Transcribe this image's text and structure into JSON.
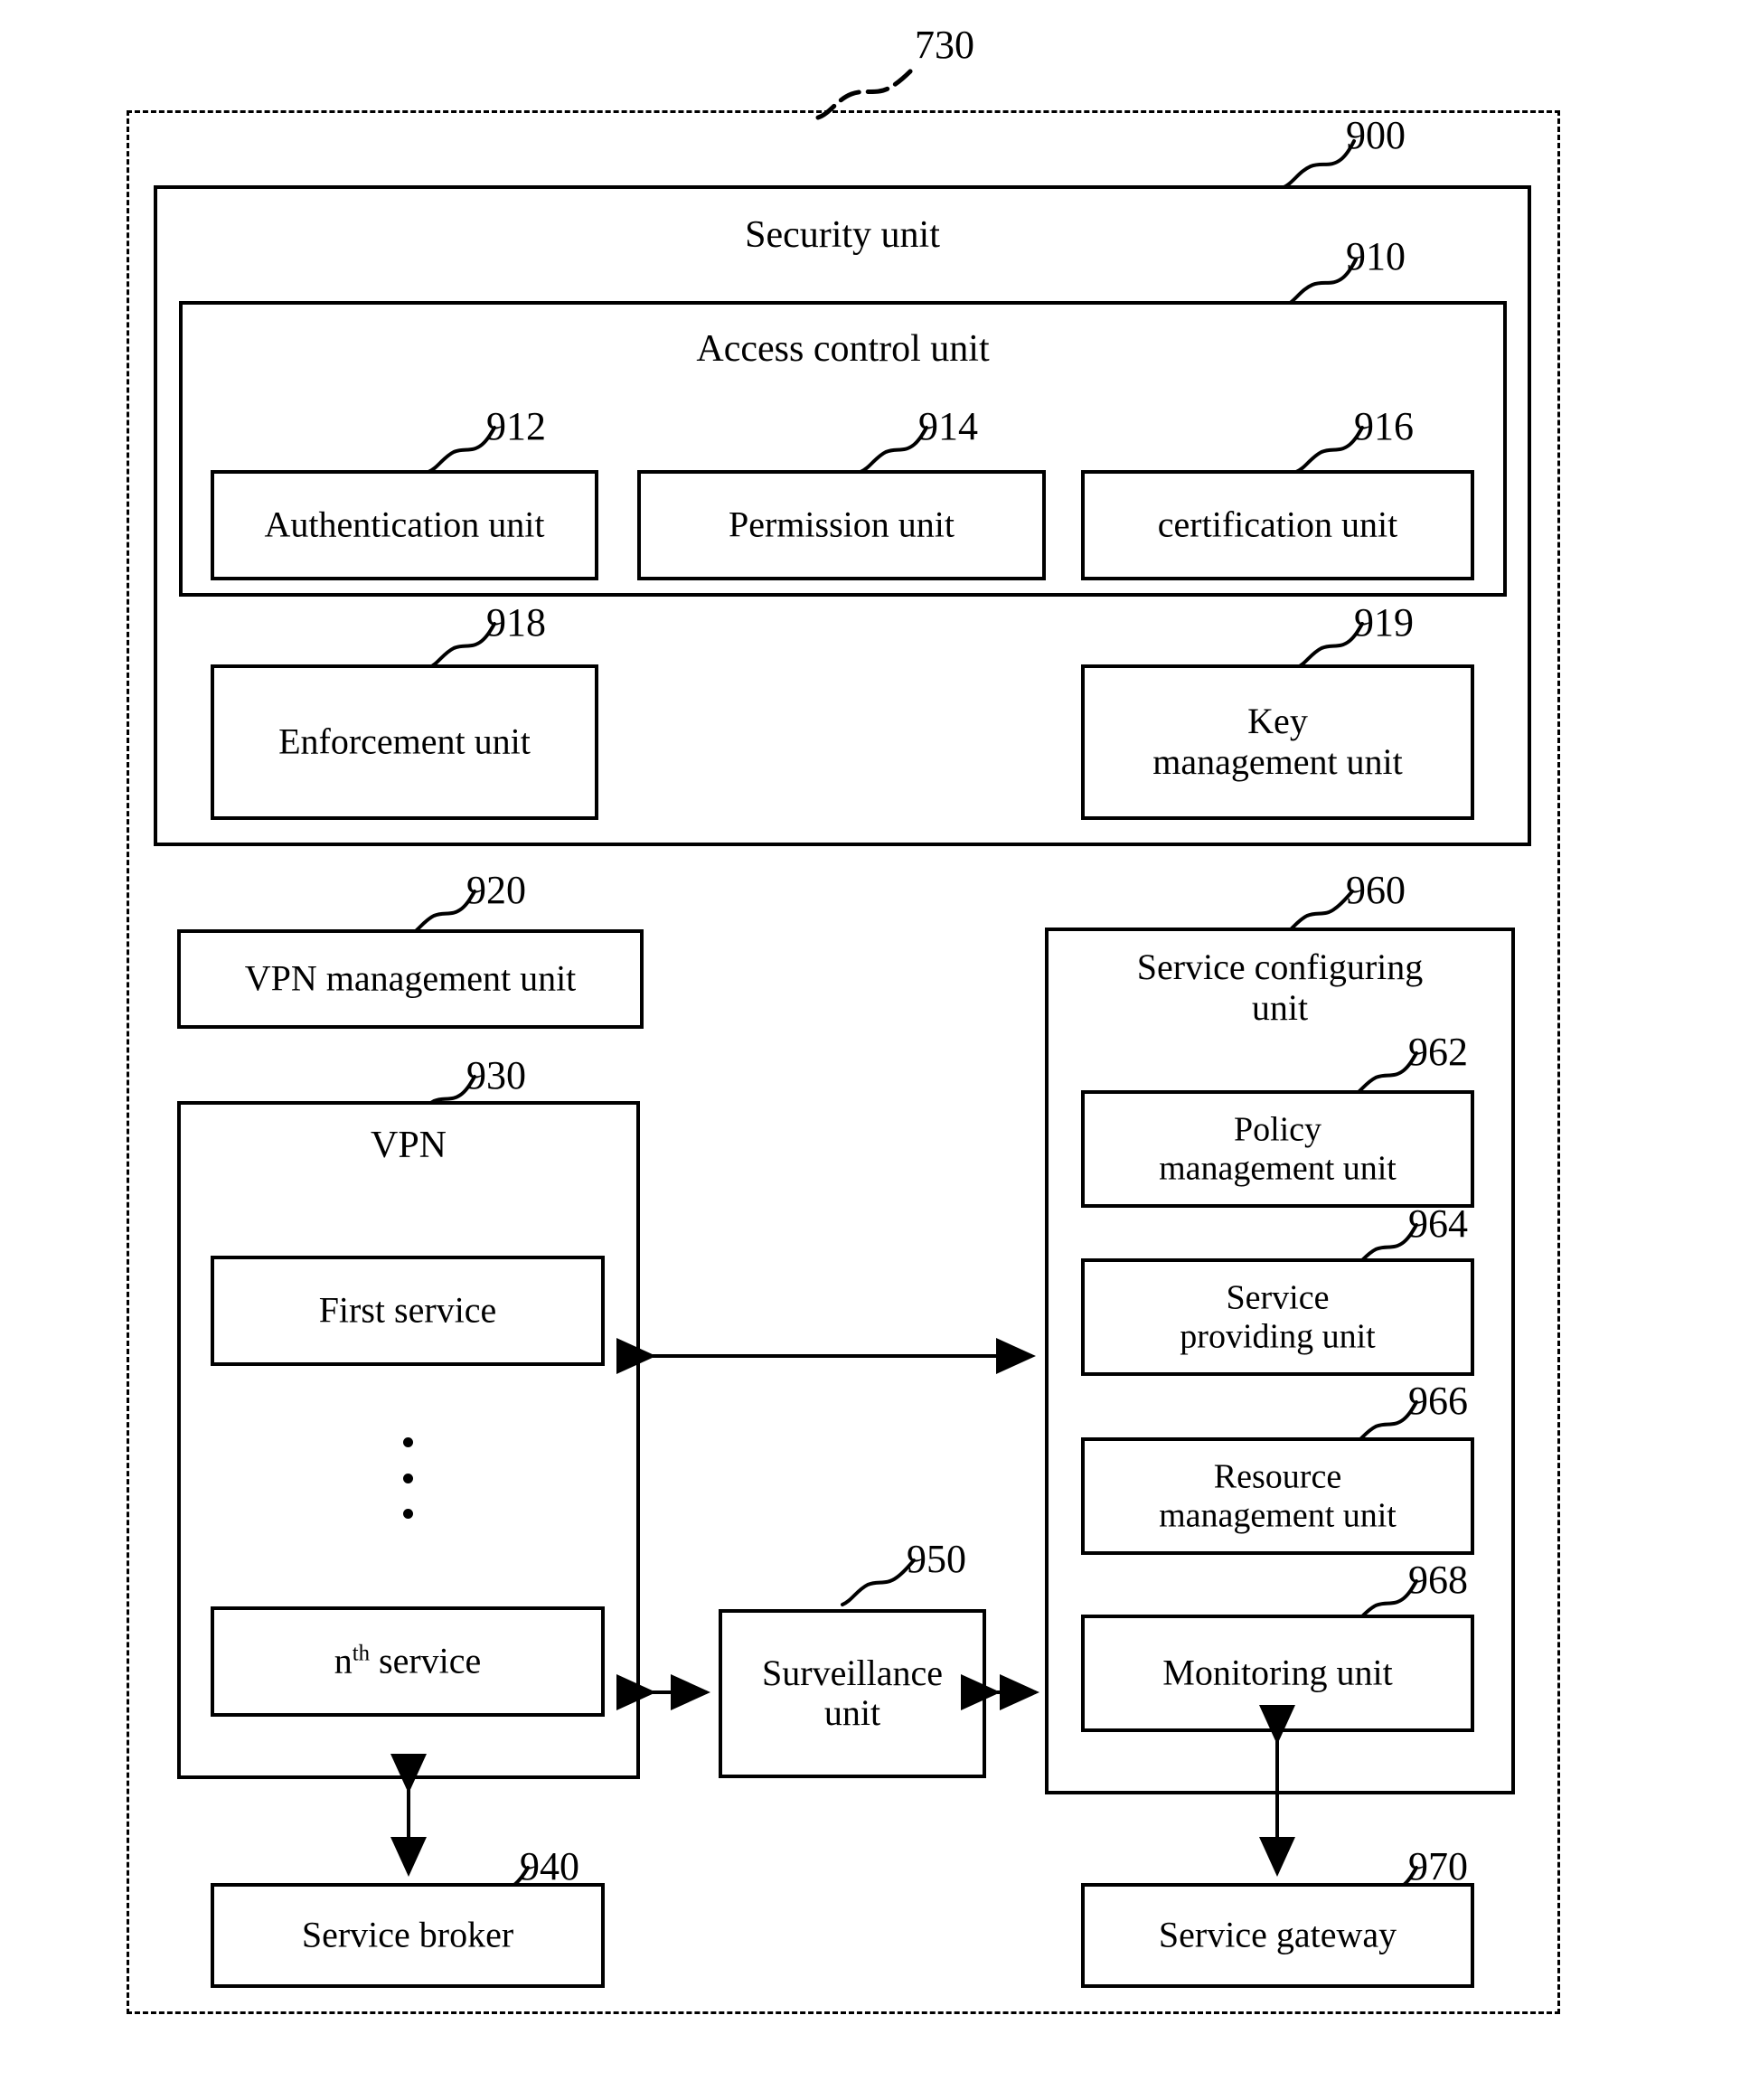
{
  "figure": {
    "outer_ref": "730",
    "security_unit": {
      "ref": "900",
      "title": "Security unit",
      "access_control_unit": {
        "ref": "910",
        "title": "Access control unit",
        "sub_units": [
          {
            "ref": "912",
            "label": "Authentication unit"
          },
          {
            "ref": "914",
            "label": "Permission unit"
          },
          {
            "ref": "916",
            "label": "certification unit"
          }
        ]
      },
      "other_units": [
        {
          "ref": "918",
          "label": "Enforcement unit"
        },
        {
          "ref": "919",
          "label": "Key\nmanagement unit"
        }
      ]
    },
    "vpn_management_unit": {
      "ref": "920",
      "label": "VPN management unit"
    },
    "vpn": {
      "ref": "930",
      "title": "VPN",
      "services": [
        {
          "label": "First service"
        },
        {
          "label_prefix": "n",
          "label_sup": "th",
          "label_suffix": " service"
        }
      ],
      "ellipsis": "⋮"
    },
    "service_broker": {
      "ref": "940",
      "label": "Service broker"
    },
    "surveillance_unit": {
      "ref": "950",
      "label": "Surveillance\nunit"
    },
    "service_configuring_unit": {
      "ref": "960",
      "title": "Service configuring\nunit",
      "sub_units": [
        {
          "ref": "962",
          "label": "Policy\nmanagement unit"
        },
        {
          "ref": "964",
          "label": "Service\nproviding unit"
        },
        {
          "ref": "966",
          "label": "Resource\nmanagement unit"
        },
        {
          "ref": "968",
          "label": "Monitoring unit"
        }
      ]
    },
    "service_gateway": {
      "ref": "970",
      "label": "Service gateway"
    },
    "colors": {
      "line": "#000000",
      "background": "#ffffff"
    }
  }
}
